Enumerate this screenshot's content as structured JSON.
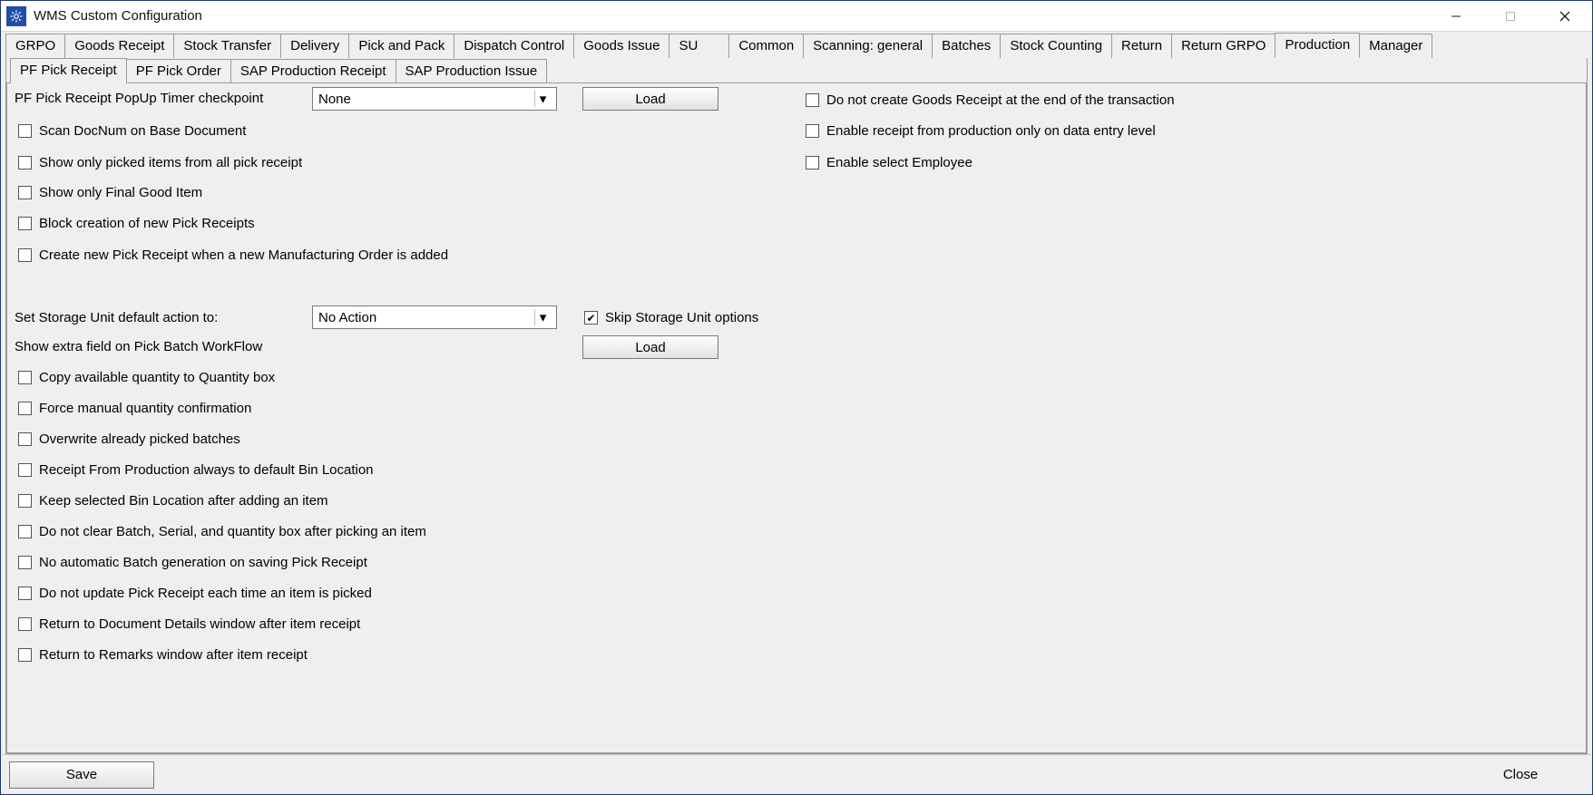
{
  "window": {
    "title": "WMS Custom Configuration"
  },
  "tabs_top": [
    "GRPO",
    "Goods Receipt",
    "Stock Transfer",
    "Delivery",
    "Pick and Pack",
    "Dispatch Control",
    "Goods Issue",
    "SU",
    "Common",
    "Scanning: general",
    "Batches",
    "Stock Counting",
    "Return",
    "Return GRPO",
    "Production",
    "Manager"
  ],
  "tabs_top_selected": 14,
  "tabs_sub": [
    "PF Pick Receipt",
    "PF Pick Order",
    "SAP Production Receipt",
    "SAP Production Issue"
  ],
  "tabs_sub_selected": 0,
  "form": {
    "popup_timer_label": "PF Pick Receipt PopUp Timer checkpoint",
    "popup_timer_value": "None",
    "load1": "Load",
    "chk_scan_docnum": "Scan DocNum on Base Document",
    "chk_show_picked": "Show only picked items from all pick receipt",
    "chk_show_final_good": "Show only Final Good Item",
    "chk_block_new_pr": "Block creation of new Pick Receipts",
    "chk_create_new_pr_on_mo": "Create new Pick Receipt when a new Manufacturing Order is added",
    "chk_no_gr_end": "Do not create Goods Receipt at the end of the transaction",
    "chk_enable_receipt_prod": "Enable receipt from production only on data entry level",
    "chk_enable_select_emp": "Enable select Employee",
    "su_label": "Set Storage Unit default action to:",
    "su_value": "No Action",
    "chk_skip_su": "Skip Storage Unit options",
    "extra_field_label": "Show extra field on Pick Batch WorkFlow",
    "load2": "Load",
    "chk_copy_qty": "Copy available quantity to Quantity box",
    "chk_force_qty_confirm": "Force manual quantity confirmation",
    "chk_overwrite_batches": "Overwrite already picked batches",
    "chk_receipt_default_bin": "Receipt From Production always to default Bin Location",
    "chk_keep_bin": "Keep selected Bin Location after adding an item",
    "chk_no_clear_batch": "Do not clear Batch, Serial, and quantity box after picking an item",
    "chk_no_auto_batch_gen": "No automatic Batch generation on saving Pick Receipt",
    "chk_no_update_pr": "Do not update Pick Receipt each time an item is picked",
    "chk_return_doc_details": "Return to Document Details window after item receipt",
    "chk_return_remarks": "Return to Remarks window after item receipt"
  },
  "footer": {
    "save": "Save",
    "close": "Close"
  }
}
